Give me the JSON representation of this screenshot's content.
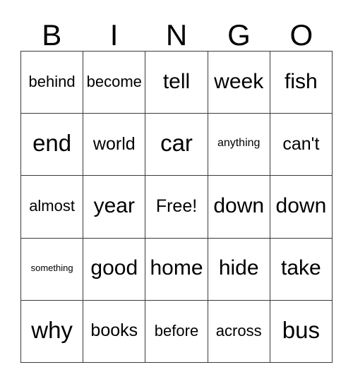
{
  "card": {
    "title": "BINGO",
    "headers": [
      "B",
      "I",
      "N",
      "G",
      "O"
    ],
    "free_space_label": "Free!",
    "colors": {
      "border": "#3a3a3a",
      "text": "#000000",
      "background": "#ffffff"
    },
    "rows": [
      [
        "behind",
        "become",
        "tell",
        "week",
        "fish"
      ],
      [
        "end",
        "world",
        "car",
        "anything",
        "can't"
      ],
      [
        "almost",
        "year",
        "Free!",
        "down",
        "down"
      ],
      [
        "something",
        "good",
        "home",
        "hide",
        "take"
      ],
      [
        "why",
        "books",
        "before",
        "across",
        "bus"
      ]
    ]
  }
}
